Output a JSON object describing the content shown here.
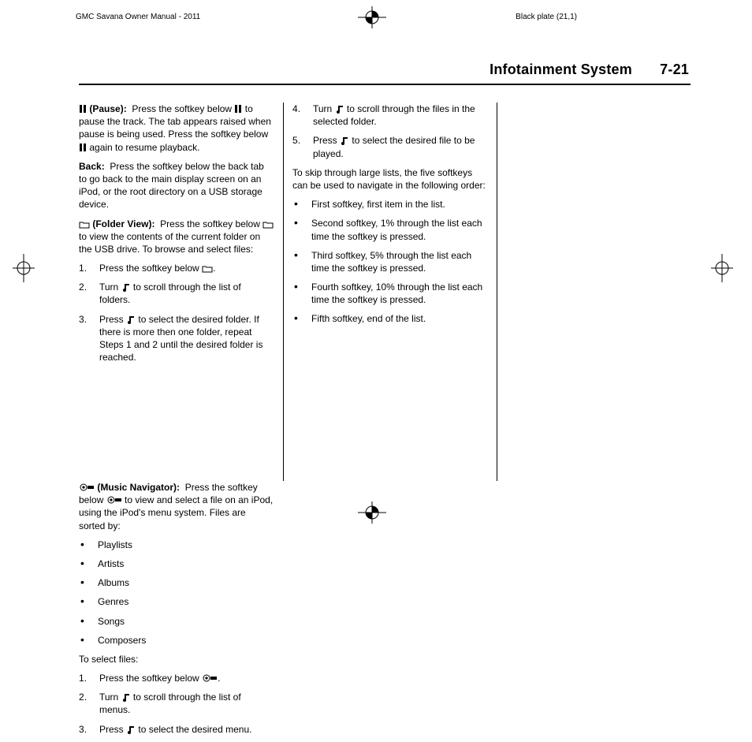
{
  "top": {
    "manual_title": "GMC Savana Owner Manual - 2011",
    "plate_label": "Black plate (21,1)"
  },
  "header": {
    "section": "Infotainment System",
    "page": "7-21"
  },
  "col1": {
    "pause_label": "(Pause):",
    "pause_1": "Press the softkey below",
    "pause_2": "to pause the track. The tab appears raised when pause is being used. Press the softkey below",
    "pause_3": "again to resume playback.",
    "back_label": "Back:",
    "back_body": "Press the softkey below the back tab to go back to the main display screen on an iPod, or the root directory on a USB storage device.",
    "folder_label": "(Folder View):",
    "folder_1": "Press the softkey below",
    "folder_2": "to view the contents of the current folder on the USB drive. To browse and select files:",
    "steps": [
      {
        "a": "Press the softkey below",
        "b": "."
      },
      {
        "a": "Turn",
        "b": "to scroll through the list of folders."
      },
      {
        "a": "Press",
        "b": "to select the desired folder. If there is more then one folder, repeat Steps 1 and 2 until the desired folder is reached."
      }
    ]
  },
  "col2": {
    "steps": [
      {
        "a": "Turn",
        "b": "to scroll through the files in the selected folder."
      },
      {
        "a": "Press",
        "b": "to select the desired file to be played."
      }
    ],
    "para": "To skip through large lists, the five softkeys can be used to navigate in the following order:",
    "bullets": [
      "First softkey, first item in the list.",
      "Second softkey, 1% through the list each time the softkey is pressed.",
      "Third softkey, 5% through the list each time the softkey is pressed.",
      "Fourth softkey, 10% through the list each time the softkey is pressed.",
      "Fifth softkey, end of the list."
    ]
  },
  "col3": {
    "nav_label": "(Music Navigator):",
    "nav_1": "Press the softkey below",
    "nav_2": "to view and select a file on an iPod, using the iPod's menu system. Files are sorted by:",
    "cats": [
      "Playlists",
      "Artists",
      "Albums",
      "Genres",
      "Songs",
      "Composers"
    ],
    "select_label": "To select files:",
    "steps": [
      {
        "a": "Press the softkey below",
        "b": "."
      },
      {
        "a": "Turn",
        "b": "to scroll through the list of menus."
      },
      {
        "a": "Press",
        "b": "to select the desired menu."
      }
    ]
  }
}
